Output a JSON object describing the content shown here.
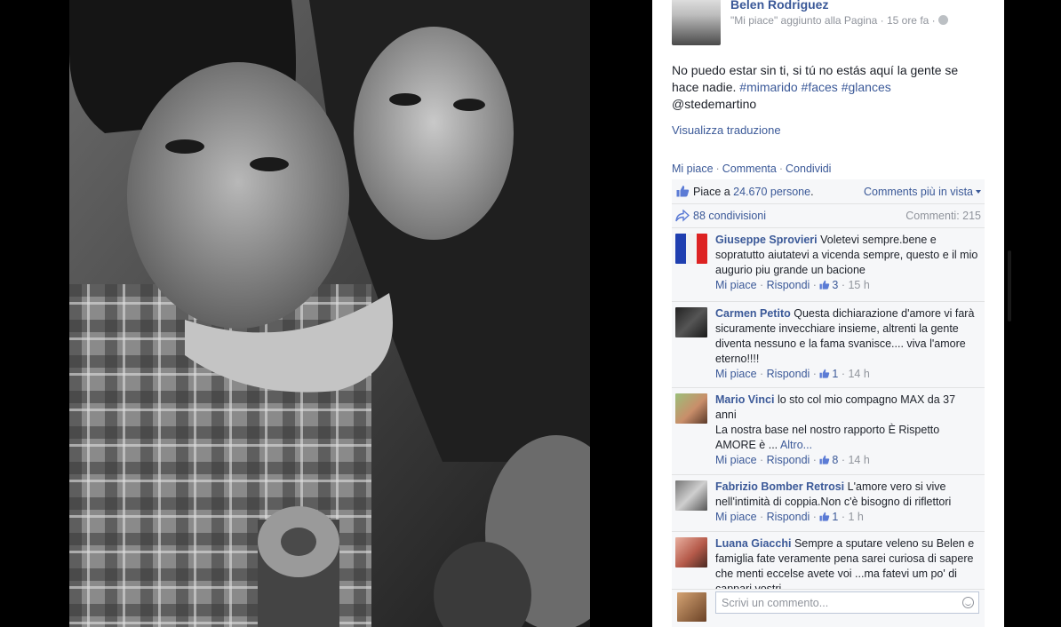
{
  "page": {
    "name": "Belen Rodriguez",
    "subtitle": "\"Mi piace\" aggiunto alla Pagina · 15 ore fa ·"
  },
  "post": {
    "text_1": "No puedo estar sin ti, si tú no estás aquí la gente se hace nadie. ",
    "hashtags": [
      "#mimarido",
      "#faces",
      "#glances"
    ],
    "mention": "@stedemartino",
    "translate_link": "Visualizza traduzione"
  },
  "actions": {
    "like": "Mi piace",
    "comment": "Commenta",
    "share": "Condividi",
    "separator": "·"
  },
  "likes": {
    "prefix": "Piace a ",
    "count_link": "24.670 persone",
    "suffix": ".",
    "sort_label": "Comments più in vista"
  },
  "shares": {
    "label": "88 condivisioni",
    "comment_count": "Commenti: 215"
  },
  "comments": [
    {
      "name": "Giuseppe Sprovieri",
      "text": "Voletevi sempre.bene e sopratutto aiutatevi a vicenda sempre, questo e il mio augurio piu grande un bacione",
      "like": "Mi piace",
      "reply": "Rispondi",
      "likes": "3",
      "time": "15 h"
    },
    {
      "name": "Carmen Petito",
      "text": "Questa dichiarazione d'amore vi farà sicuramente invecchiare insieme, altrenti la gente diventa nessuno e la fama svanisce.... viva l'amore eterno!!!!",
      "like": "Mi piace",
      "reply": "Rispondi",
      "likes": "1",
      "time": "14 h"
    },
    {
      "name": "Mario Vinci",
      "text": "lo sto col mio compagno MAX da 37 anni",
      "text_2": "La nostra base nel nostro rapporto È Rispetto AMORE è ... ",
      "more": "Altro...",
      "like": "Mi piace",
      "reply": "Rispondi",
      "likes": "8",
      "time": "14 h"
    },
    {
      "name": "Fabrizio Bomber Retrosi",
      "text": "L'amore vero si vive nell'intimità di coppia.Non c'è bisogno di riflettori",
      "like": "Mi piace",
      "reply": "Rispondi",
      "likes": "1",
      "time": "1 h"
    },
    {
      "name": "Luana Giacchi",
      "text": "Sempre a sputare veleno su Belen e famiglia fate veramente pena sarei curiosa di sapere che menti eccelse avete voi ...ma fatevi um po' di cappari vostri",
      "like": "Mi piace",
      "reply": "Rispondi",
      "likes": "",
      "time": ""
    }
  ],
  "composer": {
    "placeholder": "Scrivi un commento..."
  },
  "colors": {
    "link": "#3b5998",
    "meta": "#90949c",
    "ufi_bg": "#f6f7f9"
  }
}
